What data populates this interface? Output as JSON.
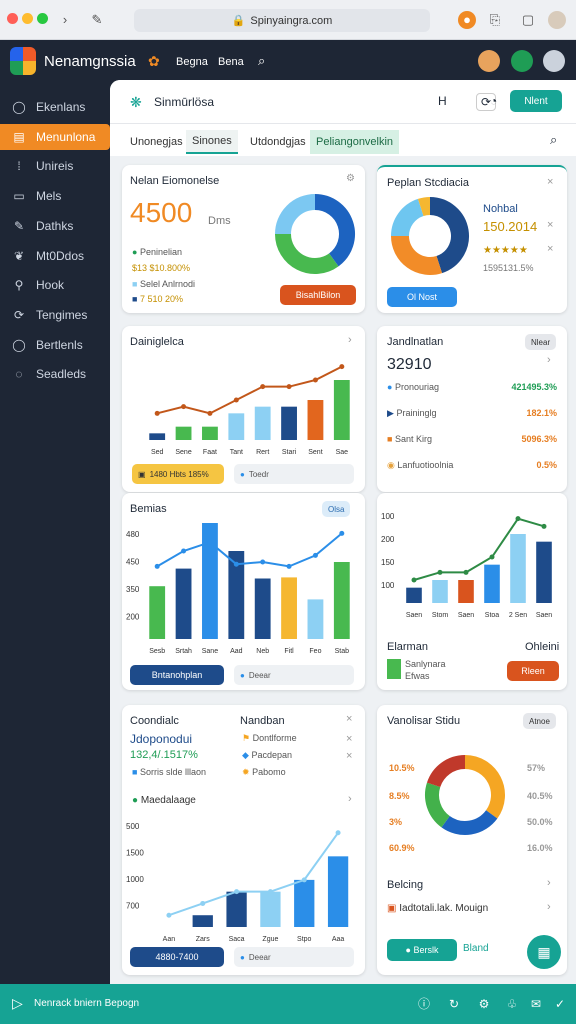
{
  "browser": {
    "url": "Spinyaingra.com"
  },
  "app": {
    "title": "Nenamgnssia",
    "links": [
      "Begna",
      "Bena"
    ]
  },
  "sidebar": {
    "items": [
      {
        "label": "Ekenlans",
        "icon": "circle-icon"
      },
      {
        "label": "Menunlona",
        "icon": "grid-icon",
        "active": true
      },
      {
        "label": "Unireis",
        "icon": "dots-icon"
      },
      {
        "label": "Mels",
        "icon": "inbox-icon"
      },
      {
        "label": "Dathks",
        "icon": "pen-icon"
      },
      {
        "label": "Mt0Ddos",
        "icon": "leaf-icon"
      },
      {
        "label": "Hook",
        "icon": "link-icon"
      },
      {
        "label": "Tengimes",
        "icon": "share-icon"
      },
      {
        "label": "Bertlenls",
        "icon": "ring-icon"
      },
      {
        "label": "Seadleds",
        "icon": "chat-icon"
      }
    ]
  },
  "header": {
    "title": "Sinmūrlösa",
    "tool_a": "H",
    "action": "Nlent"
  },
  "tabs": [
    "Unonegjas",
    "Sinones",
    "Utdondgjas",
    "Peliangonvelkin"
  ],
  "card1": {
    "title": "Nelan Eiomonelse",
    "big": "4500",
    "unit": "Dms",
    "rows": [
      "Peninelian",
      "$13 $10.800%",
      "Selel Anlrnodi",
      "7 510 20%"
    ],
    "button": "BisahlBilon",
    "chart_data": {
      "type": "pie",
      "values": [
        40,
        35,
        25
      ],
      "colors": [
        "#1d63c0",
        "#48b94f",
        "#7cc8f2"
      ]
    }
  },
  "card2": {
    "title": "Peplan Stcdiacia",
    "lines": [
      "Nohbal",
      "150.2014",
      "★★★★★",
      "1595131.5%"
    ],
    "button": "Ol Nost",
    "chart_data": {
      "type": "pie",
      "values": [
        45,
        30,
        20,
        5
      ],
      "colors": [
        "#1e4b8a",
        "#f28c28",
        "#6ec6f0",
        "#f5b731"
      ]
    }
  },
  "card3": {
    "title": "Dainiglelca",
    "badge": "1480 Hbts 185%",
    "pill": "Toedr",
    "chart_data": {
      "type": "bar",
      "categories": [
        "Sed",
        "Sene",
        "Faat",
        "Tant",
        "Rert",
        "Stari",
        "Sent",
        "Sae"
      ],
      "values": [
        1,
        2,
        2,
        4,
        5,
        5,
        6,
        9
      ],
      "line": [
        4,
        5,
        4,
        6,
        8,
        8,
        9,
        11
      ],
      "ylim": [
        0,
        12
      ]
    }
  },
  "card4": {
    "title": "Jandlnatlan",
    "tag": "Nlear",
    "big": "32910",
    "rows": [
      {
        "label": "Pronouriag",
        "value": "421495.3%",
        "color": "#1f9d55"
      },
      {
        "label": "Praininglg",
        "value": "182.1%",
        "color": "#e67e22"
      },
      {
        "label": "Sant Kirg",
        "value": "5096.3%",
        "color": "#e67e22"
      },
      {
        "label": "Lanfuotioolnia",
        "value": "0.5%",
        "color": "#e67e22"
      }
    ]
  },
  "card5": {
    "title": "Bemias",
    "tag": "Olsa",
    "button": "Bntanohplan",
    "pill": "Deear",
    "chart_data": {
      "type": "bar",
      "categories": [
        "Sesb",
        "Srtah",
        "Sane",
        "Aad",
        "Neb",
        "Fitl",
        "Feo",
        "Stab"
      ],
      "values": [
        240,
        320,
        580,
        400,
        275,
        280,
        180,
        350,
        500
      ],
      "line": [
        330,
        400,
        440,
        340,
        350,
        330,
        380,
        480
      ],
      "ylim": [
        0,
        500
      ],
      "ticks": [
        "480",
        "450",
        "350",
        "200"
      ]
    }
  },
  "card6": {
    "title": "Elarman",
    "right": "Ohleini",
    "label1": "Sanlynara",
    "label2": "Efwas",
    "button": "Rleen",
    "chart_data": {
      "type": "bar",
      "categories": [
        "Saen",
        "Stom",
        "Saen",
        "Stoa",
        "2 Sen",
        "Saen"
      ],
      "values": [
        2,
        3,
        3,
        5,
        9,
        8
      ],
      "line": [
        3,
        4,
        4,
        6,
        11,
        10
      ],
      "ylim": [
        0,
        12
      ],
      "ticks": [
        "100",
        "200",
        "150",
        "100"
      ]
    }
  },
  "card7": {
    "title": "Coondialc",
    "subtitle": "Nandban",
    "items": [
      "Jdoponodui",
      "Dontlforme",
      "Pacdepan",
      "Pabomo"
    ],
    "value": "132,4/.1517%",
    "note": "Sorris slde lllaon",
    "heading": "Maedalaage",
    "button": "4880-7400",
    "pill": "Deear",
    "chart_data": {
      "type": "bar",
      "categories": [
        "Aan",
        "Zars",
        "Saca",
        "Zgue",
        "Stpo",
        "Aaa"
      ],
      "values": [
        0,
        1,
        3,
        3,
        4,
        6
      ],
      "line": [
        1,
        2,
        3,
        3,
        4,
        8
      ],
      "ylim": [
        0,
        9
      ],
      "ticks": [
        "500",
        "1500",
        "1000",
        "700"
      ]
    }
  },
  "card8": {
    "title": "Vanolisar Stidu",
    "tag": "Atnoe",
    "labels": [
      "10.5%",
      "57%",
      "8.5%",
      "40.5%",
      "3%",
      "50.0%",
      "60.9%",
      "16.0%"
    ],
    "footer1": "Belcing",
    "footer2": "Iadtotali.lak. Mouign",
    "button1": "Berslk",
    "button2": "Bland",
    "chart_data": {
      "type": "pie",
      "values": [
        35,
        25,
        20,
        20
      ],
      "colors": [
        "#f5a623",
        "#1d63c0",
        "#43b14b",
        "#c0392b"
      ]
    }
  },
  "status": {
    "text": "Nenrack bniern Bepogn"
  },
  "colors": {
    "accent": "#16a394",
    "orange": "#f08a24",
    "navy": "#1e2635"
  }
}
